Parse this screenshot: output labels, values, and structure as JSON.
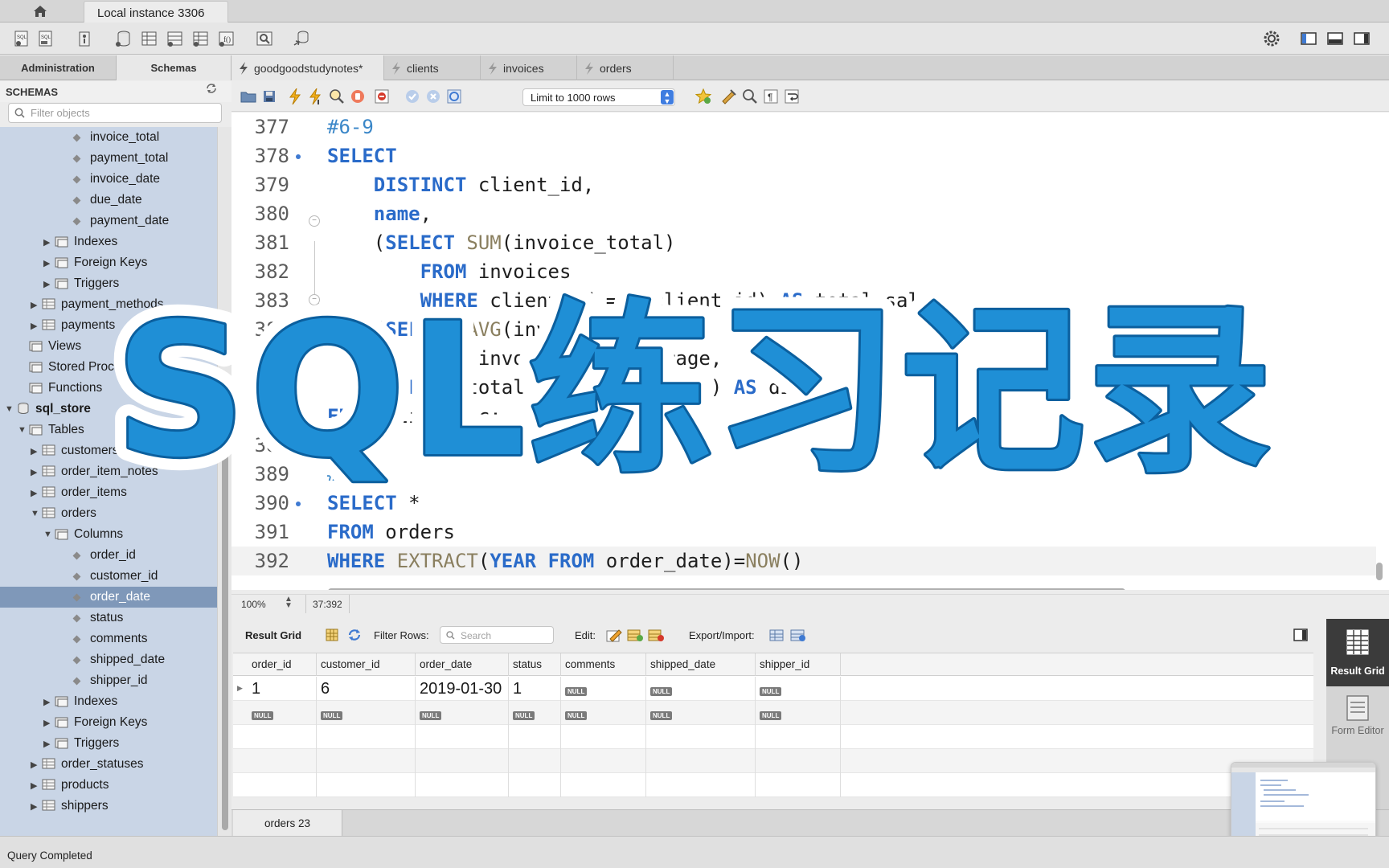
{
  "window": {
    "connection_tab": "Local instance 3306"
  },
  "side_tabs": [
    "Administration",
    "Schemas"
  ],
  "schemas": {
    "header": "SCHEMAS",
    "filter_placeholder": "Filter objects",
    "tree": [
      {
        "label": "invoice_total",
        "depth": 3,
        "kind": "column"
      },
      {
        "label": "payment_total",
        "depth": 3,
        "kind": "column"
      },
      {
        "label": "invoice_date",
        "depth": 3,
        "kind": "column"
      },
      {
        "label": "due_date",
        "depth": 3,
        "kind": "column"
      },
      {
        "label": "payment_date",
        "depth": 3,
        "kind": "column"
      },
      {
        "label": "Indexes",
        "depth": 2,
        "kind": "folder",
        "state": "collapsed"
      },
      {
        "label": "Foreign Keys",
        "depth": 2,
        "kind": "folder",
        "state": "collapsed"
      },
      {
        "label": "Triggers",
        "depth": 2,
        "kind": "folder",
        "state": "collapsed"
      },
      {
        "label": "payment_methods",
        "depth": 1,
        "kind": "table",
        "state": "collapsed"
      },
      {
        "label": "payments",
        "depth": 1,
        "kind": "table",
        "state": "collapsed"
      },
      {
        "label": "Views",
        "depth": 0.5,
        "kind": "folder"
      },
      {
        "label": "Stored Procedures",
        "depth": 0.5,
        "kind": "folder"
      },
      {
        "label": "Functions",
        "depth": 0.5,
        "kind": "folder"
      },
      {
        "label": "sql_store",
        "depth": 0,
        "kind": "schema",
        "state": "expanded"
      },
      {
        "label": "Tables",
        "depth": 0.5,
        "kind": "folder",
        "state": "expanded"
      },
      {
        "label": "customers",
        "depth": 1,
        "kind": "table",
        "state": "collapsed"
      },
      {
        "label": "order_item_notes",
        "depth": 1,
        "kind": "table",
        "state": "collapsed"
      },
      {
        "label": "order_items",
        "depth": 1,
        "kind": "table",
        "state": "collapsed"
      },
      {
        "label": "orders",
        "depth": 1,
        "kind": "table",
        "state": "expanded"
      },
      {
        "label": "Columns",
        "depth": 2,
        "kind": "folder",
        "state": "expanded"
      },
      {
        "label": "order_id",
        "depth": 3,
        "kind": "column"
      },
      {
        "label": "customer_id",
        "depth": 3,
        "kind": "column"
      },
      {
        "label": "order_date",
        "depth": 3,
        "kind": "column",
        "selected": true
      },
      {
        "label": "status",
        "depth": 3,
        "kind": "column"
      },
      {
        "label": "comments",
        "depth": 3,
        "kind": "column"
      },
      {
        "label": "shipped_date",
        "depth": 3,
        "kind": "column"
      },
      {
        "label": "shipper_id",
        "depth": 3,
        "kind": "column"
      },
      {
        "label": "Indexes",
        "depth": 2,
        "kind": "folder",
        "state": "collapsed"
      },
      {
        "label": "Foreign Keys",
        "depth": 2,
        "kind": "folder",
        "state": "collapsed"
      },
      {
        "label": "Triggers",
        "depth": 2,
        "kind": "folder",
        "state": "collapsed"
      },
      {
        "label": "order_statuses",
        "depth": 1,
        "kind": "table",
        "state": "collapsed"
      },
      {
        "label": "products",
        "depth": 1,
        "kind": "table",
        "state": "collapsed"
      },
      {
        "label": "shippers",
        "depth": 1,
        "kind": "table",
        "state": "collapsed"
      }
    ]
  },
  "editor_tabs": [
    {
      "label": "goodgoodstudynotes*",
      "active": true
    },
    {
      "label": "clients",
      "active": false
    },
    {
      "label": "invoices",
      "active": false
    },
    {
      "label": "orders",
      "active": false
    }
  ],
  "editor_toolbar": {
    "limit": "Limit to 1000 rows"
  },
  "code": {
    "lines": [
      {
        "n": "377",
        "dot": false,
        "tokens": [
          [
            "cm",
            "#6-9"
          ]
        ]
      },
      {
        "n": "378",
        "dot": true,
        "tokens": [
          [
            "kw",
            "SELECT"
          ]
        ]
      },
      {
        "n": "379",
        "dot": false,
        "tokens": [
          [
            "",
            "    "
          ],
          [
            "kw",
            "DISTINCT"
          ],
          [
            "",
            " client_id,"
          ]
        ]
      },
      {
        "n": "380",
        "dot": false,
        "tokens": [
          [
            "",
            "    "
          ],
          [
            "kw",
            "name"
          ],
          [
            "",
            ","
          ]
        ]
      },
      {
        "n": "381",
        "dot": false,
        "tokens": [
          [
            "",
            "    ("
          ],
          [
            "kw",
            "SELECT"
          ],
          [
            "",
            " "
          ],
          [
            "fn",
            "SUM"
          ],
          [
            "",
            "(invoice_total)"
          ]
        ]
      },
      {
        "n": "382",
        "dot": false,
        "tokens": [
          [
            "",
            "        "
          ],
          [
            "kw",
            "FROM"
          ],
          [
            "",
            " invoices"
          ]
        ]
      },
      {
        "n": "383",
        "dot": false,
        "tokens": [
          [
            "",
            "        "
          ],
          [
            "kw",
            "WHERE"
          ],
          [
            "",
            " client_id = c.client_id) "
          ],
          [
            "kw",
            "AS"
          ],
          [
            "",
            " total_sales,"
          ]
        ]
      },
      {
        "n": "384",
        "dot": false,
        "tokens": [
          [
            "",
            "    ("
          ],
          [
            "kw",
            "SELECT"
          ],
          [
            "",
            " "
          ],
          [
            "fn",
            "AVG"
          ],
          [
            "",
            "(invoice_total)"
          ]
        ]
      },
      {
        "n": "385",
        "dot": false,
        "tokens": [
          [
            "",
            "        "
          ],
          [
            "kw",
            "FROM"
          ],
          [
            "",
            " invoices) "
          ],
          [
            "kw",
            "AS"
          ],
          [
            "",
            " average,"
          ]
        ]
      },
      {
        "n": "386",
        "dot": false,
        "tokens": [
          [
            "",
            "    ("
          ],
          [
            "kw",
            "SELECT"
          ],
          [
            "",
            " total_sales - average) "
          ],
          [
            "kw",
            "AS"
          ],
          [
            "",
            " difference"
          ]
        ]
      },
      {
        "n": "387",
        "dot": false,
        "tokens": [
          [
            "kw",
            "FROM"
          ],
          [
            "",
            " clients c;"
          ]
        ]
      },
      {
        "n": "388",
        "dot": false,
        "tokens": []
      },
      {
        "n": "389",
        "dot": false,
        "tokens": [
          [
            "cm",
            "#7-3"
          ]
        ]
      },
      {
        "n": "390",
        "dot": true,
        "tokens": [
          [
            "kw",
            "SELECT"
          ],
          [
            "",
            " *"
          ]
        ]
      },
      {
        "n": "391",
        "dot": false,
        "tokens": [
          [
            "kw",
            "FROM"
          ],
          [
            "",
            " orders"
          ]
        ]
      },
      {
        "n": "392",
        "dot": false,
        "current": true,
        "tokens": [
          [
            "kw",
            "WHERE"
          ],
          [
            "",
            " "
          ],
          [
            "fn",
            "EXTRACT"
          ],
          [
            "",
            "("
          ],
          [
            "kw",
            "YEAR"
          ],
          [
            "",
            " "
          ],
          [
            "kw",
            "FROM"
          ],
          [
            "",
            " order_date)="
          ],
          [
            "fn",
            "NOW"
          ],
          [
            "",
            "()"
          ]
        ]
      }
    ]
  },
  "editor_status": {
    "zoom": "100%",
    "caret": "37:392"
  },
  "result": {
    "label": "Result Grid",
    "filter_label": "Filter Rows:",
    "search_placeholder": "Search",
    "edit_label": "Edit:",
    "export_label": "Export/Import:",
    "columns": [
      "order_id",
      "customer_id",
      "order_date",
      "status",
      "comments",
      "shipped_date",
      "shipper_id"
    ],
    "rows": [
      [
        "1",
        "6",
        "2019-01-30",
        "1",
        "NULL",
        "NULL",
        "NULL"
      ],
      [
        "NULL",
        "NULL",
        "NULL",
        "NULL",
        "NULL",
        "NULL",
        "NULL"
      ]
    ],
    "tab": "orders 23",
    "side": {
      "result_grid": "Result Grid",
      "form_editor": "Form Editor"
    }
  },
  "status_bar": "Query Completed",
  "overlay_title": "SQL练习记录",
  "colors": {
    "accent": "#2a6bc9",
    "overlay_blue": "#1f8fd6",
    "selection": "#7f98b9",
    "tree_bg": "#c9d5e6"
  }
}
